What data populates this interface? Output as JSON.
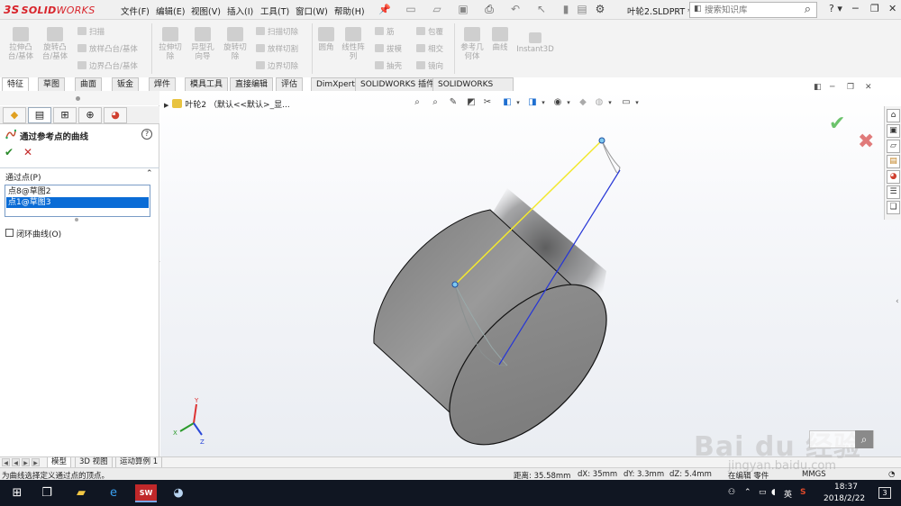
{
  "app": {
    "brand_ds": "3S",
    "brand_solid": "SOLID",
    "brand_works": "WORKS",
    "doc_name": "叶轮2.SLDPRT *",
    "search_placeholder": "搜索知识库"
  },
  "menu": [
    "文件(F)",
    "编辑(E)",
    "视图(V)",
    "插入(I)",
    "工具(T)",
    "窗口(W)",
    "帮助(H)"
  ],
  "ribbon": {
    "big": [
      {
        "label": "拉伸凸\n台/基体",
        "name": "extrude-boss"
      },
      {
        "label": "旋转凸\n台/基体",
        "name": "revolve-boss"
      },
      {
        "label": "拉伸切\n除",
        "name": "extrude-cut"
      },
      {
        "label": "异型孔\n向导",
        "name": "hole-wizard"
      },
      {
        "label": "旋转切\n除",
        "name": "revolve-cut"
      },
      {
        "label": "圆角",
        "name": "fillet"
      },
      {
        "label": "线性阵\n列",
        "name": "linear-pattern"
      },
      {
        "label": "参考几\n何体",
        "name": "reference-geometry"
      },
      {
        "label": "曲线",
        "name": "curves"
      },
      {
        "label": "Instant3D",
        "name": "instant3d"
      }
    ],
    "small": [
      {
        "label": "扫描",
        "name": "sweep"
      },
      {
        "label": "放样凸台/基体",
        "name": "loft-boss"
      },
      {
        "label": "边界凸台/基体",
        "name": "boundary-boss"
      },
      {
        "label": "扫描切除",
        "name": "swept-cut"
      },
      {
        "label": "放样切割",
        "name": "lofted-cut"
      },
      {
        "label": "边界切除",
        "name": "boundary-cut"
      },
      {
        "label": "筋",
        "name": "rib"
      },
      {
        "label": "拔模",
        "name": "draft"
      },
      {
        "label": "抽壳",
        "name": "shell"
      },
      {
        "label": "包覆",
        "name": "wrap"
      },
      {
        "label": "相交",
        "name": "intersect"
      },
      {
        "label": "镜向",
        "name": "mirror"
      }
    ]
  },
  "tabs": [
    "特征",
    "草图",
    "曲面",
    "钣金",
    "焊件",
    "模具工具",
    "直接编辑",
    "评估",
    "DimXpert",
    "SOLIDWORKS 插件",
    "SOLIDWORKS MBD"
  ],
  "property_manager": {
    "title": "通过参考点的曲线",
    "help": "?",
    "ok": "✔",
    "cancel": "✕",
    "section_label": "通过点(P)",
    "points": [
      "点8@草图2",
      "点1@草图3"
    ],
    "closed_curve_label": "闭环曲线(O)",
    "closed_curve_checked": false
  },
  "viewport": {
    "tree_label": "叶轮2 （默认<<默认>_显...",
    "confirm_ok": "✔",
    "confirm_cancel": "✖"
  },
  "bottom_tabs": [
    "模型",
    "3D 视图",
    "运动算例 1"
  ],
  "status": {
    "message": "为曲线选择定义通过点的顶点。",
    "distance": "距离: 35.58mm",
    "dx": "dX: 35mm",
    "dy": "dY: 3.3mm",
    "dz": "dZ: 5.4mm",
    "mode": "在编辑 零件",
    "units": "MMGS"
  },
  "taskbar": {
    "time": "18:37",
    "date": "2018/2/22",
    "ime": "英",
    "notifications": "3"
  },
  "watermark": {
    "main": "Bai du 经验",
    "sub": "jingyan.baidu.com"
  },
  "colors": {
    "accent_red": "#d8232a",
    "selection_blue": "#0a6cd6",
    "yellow_line": "#f2e830",
    "blue_line": "#2636d6"
  }
}
